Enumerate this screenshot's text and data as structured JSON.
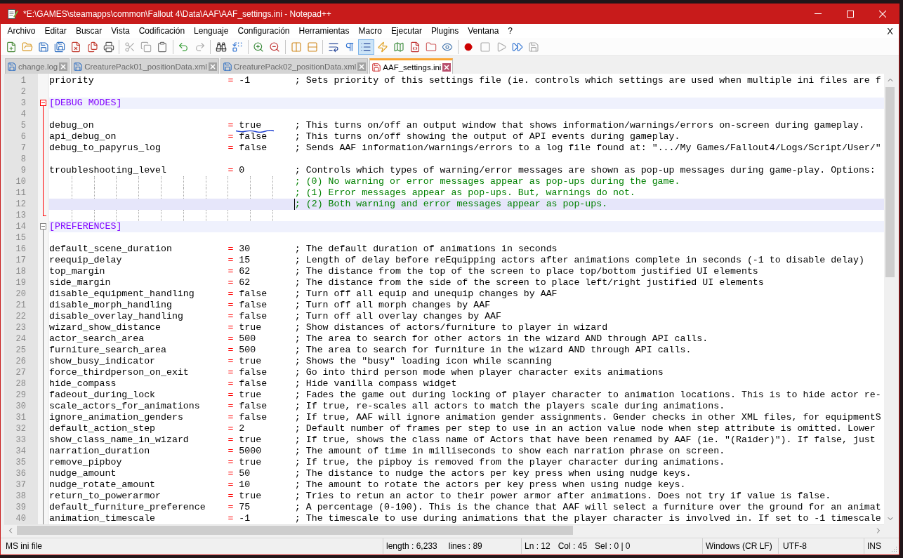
{
  "window": {
    "title": "*E:\\GAMES\\steamapps\\common\\Fallout 4\\Data\\AAF\\AAF_settings.ini - Notepad++"
  },
  "menu": {
    "items": [
      "Archivo",
      "Editar",
      "Buscar",
      "Vista",
      "Codificación",
      "Lenguaje",
      "Configuración",
      "Herramientas",
      "Macro",
      "Ejecutar",
      "Plugins",
      "Ventana",
      "?"
    ],
    "close": "X"
  },
  "toolbar": [
    {
      "kind": "new",
      "pressed": false,
      "disabled": false
    },
    {
      "kind": "open",
      "pressed": false,
      "disabled": false
    },
    {
      "kind": "save",
      "pressed": false,
      "disabled": false
    },
    {
      "kind": "save-all",
      "pressed": false,
      "disabled": false
    },
    {
      "kind": "close",
      "pressed": false,
      "disabled": false
    },
    {
      "kind": "close-all",
      "pressed": false,
      "disabled": false
    },
    {
      "kind": "print",
      "pressed": false,
      "disabled": false
    },
    {
      "kind": "separator"
    },
    {
      "kind": "cut",
      "pressed": false,
      "disabled": true
    },
    {
      "kind": "copy",
      "pressed": false,
      "disabled": true
    },
    {
      "kind": "paste",
      "pressed": false,
      "disabled": false
    },
    {
      "kind": "separator"
    },
    {
      "kind": "undo",
      "pressed": false,
      "disabled": false
    },
    {
      "kind": "redo",
      "pressed": false,
      "disabled": true
    },
    {
      "kind": "separator"
    },
    {
      "kind": "find",
      "pressed": false,
      "disabled": false
    },
    {
      "kind": "replace",
      "pressed": false,
      "disabled": false
    },
    {
      "kind": "separator"
    },
    {
      "kind": "zoom-in",
      "pressed": false,
      "disabled": false
    },
    {
      "kind": "zoom-out",
      "pressed": false,
      "disabled": false
    },
    {
      "kind": "separator"
    },
    {
      "kind": "sync-vertical",
      "pressed": false,
      "disabled": false
    },
    {
      "kind": "sync-horizontal",
      "pressed": false,
      "disabled": false
    },
    {
      "kind": "separator"
    },
    {
      "kind": "wrap",
      "pressed": false,
      "disabled": false
    },
    {
      "kind": "all-chars",
      "pressed": false,
      "disabled": false
    },
    {
      "kind": "indent-guide",
      "pressed": true,
      "disabled": false
    },
    {
      "kind": "user-language",
      "pressed": false,
      "disabled": false
    },
    {
      "kind": "document-map",
      "pressed": false,
      "disabled": false
    },
    {
      "kind": "function-list",
      "pressed": false,
      "disabled": false
    },
    {
      "kind": "folder-workspace",
      "pressed": false,
      "disabled": false
    },
    {
      "kind": "monitoring",
      "pressed": false,
      "disabled": false
    },
    {
      "kind": "separator"
    },
    {
      "kind": "record",
      "pressed": false,
      "disabled": false
    },
    {
      "kind": "stop",
      "pressed": false,
      "disabled": true
    },
    {
      "kind": "play",
      "pressed": false,
      "disabled": true
    },
    {
      "kind": "run-multiple",
      "pressed": false,
      "disabled": false
    },
    {
      "kind": "save-macro",
      "pressed": false,
      "disabled": true
    }
  ],
  "tabs": [
    {
      "label": "change.log",
      "selected": false,
      "modified": false
    },
    {
      "label": "CreaturePack01_positionData.xml",
      "selected": false,
      "modified": false
    },
    {
      "label": "CreaturePack02_positionData.xml",
      "selected": false,
      "modified": false
    },
    {
      "label": "AAF_settings.ini",
      "selected": true,
      "modified": true
    }
  ],
  "editor": {
    "lines": [
      {
        "number": "1",
        "kind": "setting",
        "key": "priority",
        "operator": "=",
        "value": "-1",
        "comment": "; Sets priority of this settings file (ie. controls which settings are used when multiple ini files are f",
        "underlined": false,
        "current": false
      },
      {
        "number": "2",
        "kind": "blank",
        "current": false
      },
      {
        "number": "3",
        "kind": "section",
        "text": "[DEBUG MODES]",
        "expanded": true,
        "current": false
      },
      {
        "number": "4",
        "kind": "blank",
        "current": false
      },
      {
        "number": "5",
        "kind": "setting",
        "key": "debug_on",
        "operator": "=",
        "value": "true",
        "comment": "; This turns on/off an output window that shows information/warnings/errors on-screen during gameplay.",
        "underlined": true,
        "current": false
      },
      {
        "number": "6",
        "kind": "setting",
        "key": "api_debug_on",
        "operator": "=",
        "value": "false",
        "comment": "; This turns on/off showing the output of API events during gameplay.",
        "underlined": false,
        "current": false
      },
      {
        "number": "7",
        "kind": "setting",
        "key": "debug_to_papyrus_log",
        "operator": "=",
        "value": "false",
        "comment": "; Sends AAF information/warnings/errors to a log file found at: \".../My Games/Fallout4/Logs/Script/User/\"",
        "underlined": false,
        "current": false
      },
      {
        "number": "8",
        "kind": "blank",
        "current": false
      },
      {
        "number": "9",
        "kind": "setting",
        "key": "troubleshooting_level",
        "operator": "=",
        "value": "0",
        "comment": "; Controls which types of warning/error messages are shown as pop-up messages during game-play. Options:",
        "underlined": false,
        "current": false
      },
      {
        "number": "10",
        "kind": "comment",
        "text": "; (0) No warning or error messages appear as pop-ups during the game.",
        "current": false
      },
      {
        "number": "11",
        "kind": "comment",
        "text": "; (1) Error messages appear as pop-ups. But, warnings do not.",
        "current": false
      },
      {
        "number": "12",
        "kind": "comment",
        "text": "; (2) Both warning and error messages appear as pop-ups.",
        "current": true
      },
      {
        "number": "13",
        "kind": "blank",
        "current": false
      },
      {
        "number": "14",
        "kind": "section",
        "text": "[PREFERENCES]",
        "expanded": true,
        "current": false
      },
      {
        "number": "15",
        "kind": "blank",
        "current": false
      },
      {
        "number": "16",
        "kind": "setting",
        "key": "default_scene_duration",
        "operator": "=",
        "value": "30",
        "comment": "; The default duration of animations in seconds",
        "underlined": false,
        "current": false
      },
      {
        "number": "17",
        "kind": "setting",
        "key": "reequip_delay",
        "operator": "=",
        "value": "15",
        "comment": "; Length of delay before reEquipping actors after animations complete in seconds (-1 to disable delay)",
        "underlined": false,
        "current": false
      },
      {
        "number": "18",
        "kind": "setting",
        "key": "top_margin",
        "operator": "=",
        "value": "62",
        "comment": "; The distance from the top of the screen to place top/bottom justified UI elements",
        "underlined": false,
        "current": false
      },
      {
        "number": "19",
        "kind": "setting",
        "key": "side_margin",
        "operator": "=",
        "value": "62",
        "comment": "; The distance from the side of the screen to place left/right justified UI elements",
        "underlined": false,
        "current": false
      },
      {
        "number": "20",
        "kind": "setting",
        "key": "disable_equipment_handling",
        "operator": "=",
        "value": "false",
        "comment": "; Turn off all equip and unequip changes by AAF",
        "underlined": false,
        "current": false
      },
      {
        "number": "21",
        "kind": "setting",
        "key": "disable_morph_handling",
        "operator": "=",
        "value": "false",
        "comment": "; Turn off all morph changes by AAF",
        "underlined": false,
        "current": false
      },
      {
        "number": "22",
        "kind": "setting",
        "key": "disable_overlay_handling",
        "operator": "=",
        "value": "false",
        "comment": "; Turn off all overlay changes by AAF",
        "underlined": false,
        "current": false
      },
      {
        "number": "23",
        "kind": "setting",
        "key": "wizard_show_distance",
        "operator": "=",
        "value": "true",
        "comment": "; Show distances of actors/furniture to player in wizard",
        "underlined": false,
        "current": false
      },
      {
        "number": "24",
        "kind": "setting",
        "key": "actor_search_area",
        "operator": "=",
        "value": "500",
        "comment": "; The area to search for other actors in the wizard AND through API calls.",
        "underlined": false,
        "current": false
      },
      {
        "number": "25",
        "kind": "setting",
        "key": "furniture_search_area",
        "operator": "=",
        "value": "500",
        "comment": "; The area to search for furniture in the wizard AND through API calls.",
        "underlined": false,
        "current": false
      },
      {
        "number": "26",
        "kind": "setting",
        "key": "show_busy_indicator",
        "operator": "=",
        "value": "true",
        "comment": "; Shows the \"busy\" loading icon while scanning",
        "underlined": false,
        "current": false
      },
      {
        "number": "27",
        "kind": "setting",
        "key": "force_thirdperson_on_exit",
        "operator": "=",
        "value": "false",
        "comment": "; Go into third person mode when player character exits animations",
        "underlined": false,
        "current": false
      },
      {
        "number": "28",
        "kind": "setting",
        "key": "hide_compass",
        "operator": "=",
        "value": "false",
        "comment": "; Hide vanilla compass widget",
        "underlined": false,
        "current": false
      },
      {
        "number": "29",
        "kind": "setting",
        "key": "fadeout_during_lock",
        "operator": "=",
        "value": "true",
        "comment": "; Fades the game out during locking of player character to animation locations. This is to hide actor re-",
        "underlined": false,
        "current": false
      },
      {
        "number": "30",
        "kind": "setting",
        "key": "scale_actors_for_animations",
        "operator": "=",
        "value": "false",
        "comment": "; If true, re-scales all actors to match the players scale during animations.",
        "underlined": false,
        "current": false
      },
      {
        "number": "31",
        "kind": "setting",
        "key": "ignore_animation_genders",
        "operator": "=",
        "value": "false",
        "comment": "; If true, AAF will ignore animation gender assignments. Gender checks in other XML files, for equipmentS",
        "underlined": false,
        "current": false
      },
      {
        "number": "32",
        "kind": "setting",
        "key": "default_action_step",
        "operator": "=",
        "value": "2",
        "comment": "; Default number of frames per step to use in an action value node when step attribute is omitted. Lower",
        "underlined": false,
        "current": false
      },
      {
        "number": "33",
        "kind": "setting",
        "key": "show_class_name_in_wizard",
        "operator": "=",
        "value": "true",
        "comment": "; If true, shows the class name of Actors that have been renamed by AAF (ie. \"(Raider)\"). If false, just",
        "underlined": false,
        "current": false
      },
      {
        "number": "34",
        "kind": "setting",
        "key": "narration_duration",
        "operator": "=",
        "value": "5000",
        "comment": "; The amount of time in milliseconds to show each narration phrase on screen.",
        "underlined": false,
        "current": false
      },
      {
        "number": "35",
        "kind": "setting",
        "key": "remove_pipboy",
        "operator": "=",
        "value": "true",
        "comment": "; If true, the pipboy is removed from the player character during animations.",
        "underlined": false,
        "current": false
      },
      {
        "number": "36",
        "kind": "setting",
        "key": "nudge_amount",
        "operator": "=",
        "value": "50",
        "comment": "; The distance to nudge the actors per key press when using nudge keys.",
        "underlined": false,
        "current": false
      },
      {
        "number": "37",
        "kind": "setting",
        "key": "nudge_rotate_amount",
        "operator": "=",
        "value": "10",
        "comment": "; The amount to rotate the actors per key press when using nudge keys.",
        "underlined": false,
        "current": false
      },
      {
        "number": "38",
        "kind": "setting",
        "key": "return_to_powerarmor",
        "operator": "=",
        "value": "true",
        "comment": "; Tries to retun an actor to their power armor after animations. Does not try if value is false.",
        "underlined": false,
        "current": false
      },
      {
        "number": "39",
        "kind": "setting",
        "key": "default_furniture_preference",
        "operator": "=",
        "value": "75",
        "comment": "; A percentage (0-100). This is the chance that AAF will select a furniture over the ground for an animat",
        "underlined": false,
        "current": false
      },
      {
        "number": "40",
        "kind": "setting",
        "key": "animation_timescale",
        "operator": "=",
        "value": "-1",
        "comment": "; The timescale to use during animations that the player character is involved in. If set to -1 timescale",
        "underlined": false,
        "current": false
      }
    ]
  },
  "status_bar": {
    "file_type": "MS ini file",
    "length": "length : 6,233",
    "lines": "lines : 89",
    "line": "Ln : 12",
    "column": "Col : 45",
    "selection": "Sel : 0 | 0",
    "line_endings": "Windows (CR LF)",
    "encoding": "UTF-8",
    "mode": "INS"
  }
}
